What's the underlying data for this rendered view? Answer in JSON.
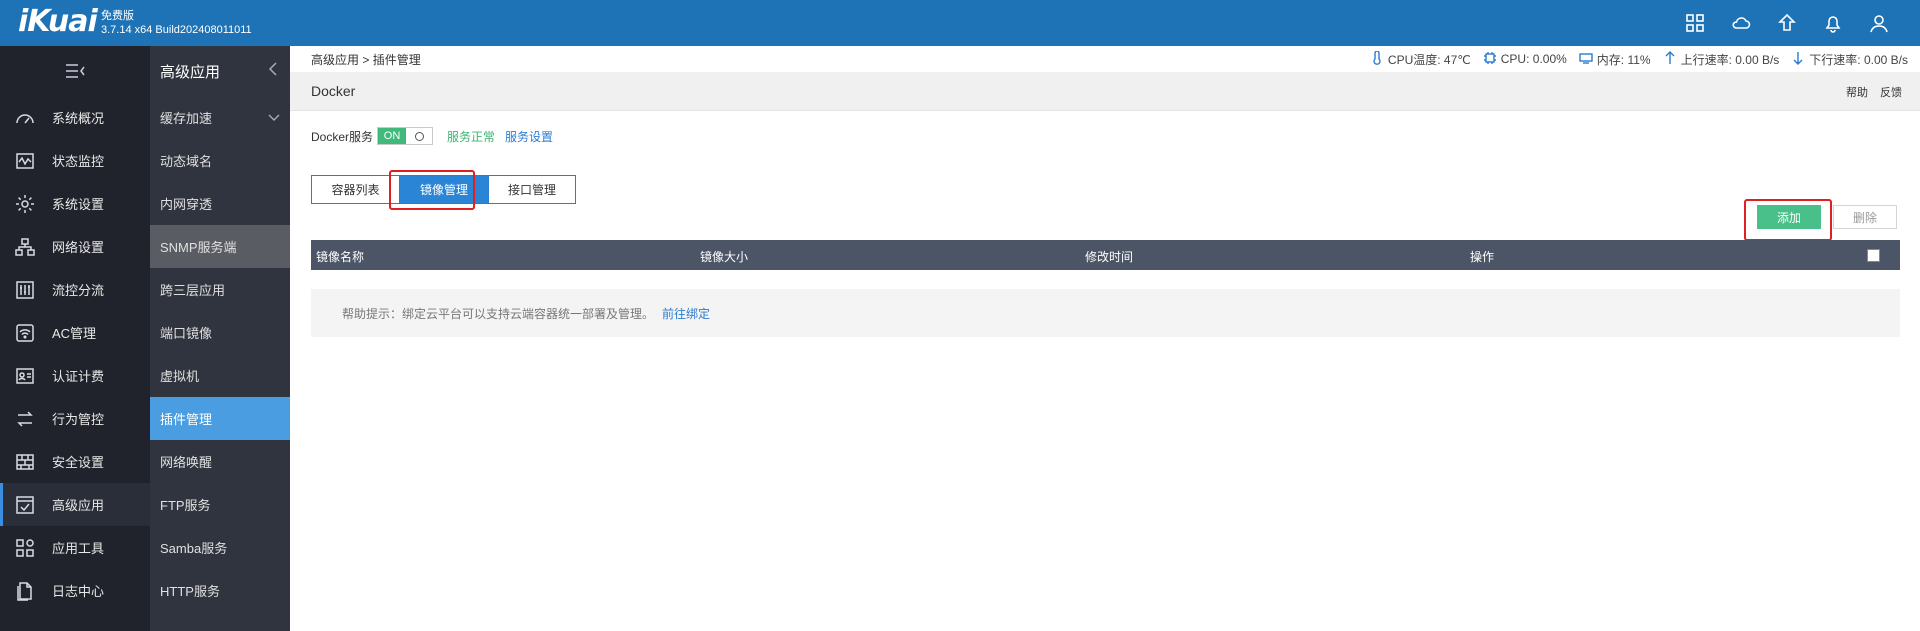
{
  "brand": {
    "logo": "iKuai",
    "edition": "免费版",
    "version": "3.7.14 x64 Build202408011011"
  },
  "top_icons": [
    "grid-icon",
    "cloud-icon",
    "upgrade-icon",
    "bell-icon",
    "user-icon"
  ],
  "nav": {
    "items": [
      {
        "label": "系统概况",
        "icon": "dashboard-icon"
      },
      {
        "label": "状态监控",
        "icon": "monitor-icon"
      },
      {
        "label": "系统设置",
        "icon": "gear-icon"
      },
      {
        "label": "网络设置",
        "icon": "network-icon"
      },
      {
        "label": "流控分流",
        "icon": "sliders-icon"
      },
      {
        "label": "AC管理",
        "icon": "wifi-icon"
      },
      {
        "label": "认证计费",
        "icon": "id-card-icon"
      },
      {
        "label": "行为管控",
        "icon": "arrows-icon"
      },
      {
        "label": "安全设置",
        "icon": "firewall-icon"
      },
      {
        "label": "高级应用",
        "icon": "check-window-icon"
      },
      {
        "label": "应用工具",
        "icon": "apps-icon"
      },
      {
        "label": "日志中心",
        "icon": "document-icon"
      }
    ]
  },
  "subnav": {
    "title": "高级应用",
    "items": [
      "缓存加速",
      "动态域名",
      "内网穿透",
      "SNMP服务端",
      "跨三层应用",
      "端口镜像",
      "虚拟机",
      "插件管理",
      "网络唤醒",
      "FTP服务",
      "Samba服务",
      "HTTP服务"
    ]
  },
  "breadcrumb": {
    "parent": "高级应用",
    "sep": ">",
    "current": "插件管理"
  },
  "stats": {
    "cpu_temp": "CPU温度: 47℃",
    "cpu": "CPU: 0.00%",
    "mem": "内存: 11%",
    "up": "上行速率: 0.00 B/s",
    "down": "下行速率: 0.00 B/s"
  },
  "page": {
    "title": "Docker",
    "help": "帮助",
    "feedback": "反馈"
  },
  "service": {
    "label": "Docker服务",
    "toggle": "ON",
    "status": "服务正常",
    "settings": "服务设置"
  },
  "tabs": [
    "容器列表",
    "镜像管理",
    "接口管理"
  ],
  "actions": {
    "add": "添加",
    "delete": "删除"
  },
  "table": {
    "columns": [
      "镜像名称",
      "镜像大小",
      "修改时间",
      "操作"
    ]
  },
  "help_tip": {
    "text": "帮助提示：绑定云平台可以支持云端容器统一部署及管理。",
    "link": "前往绑定"
  }
}
